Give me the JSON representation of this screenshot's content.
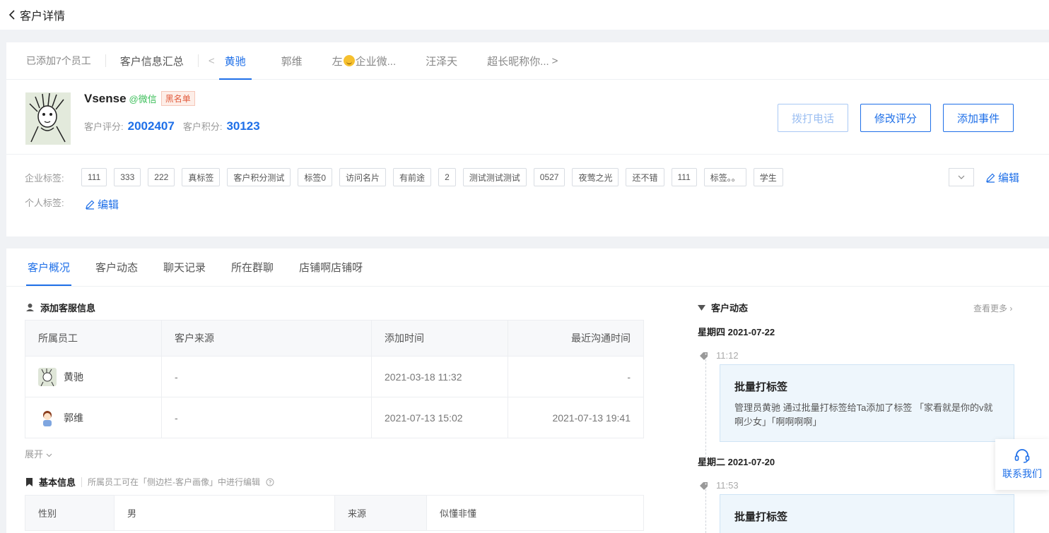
{
  "page": {
    "back_label": "客户详情"
  },
  "staff_tabs": {
    "added_count": "已添加7个员工",
    "summary": "客户信息汇总",
    "prev_arrow": "<",
    "items": [
      {
        "label": "黄驰"
      },
      {
        "label": "郭维"
      },
      {
        "label_pre": "左",
        "label_post": "企业微..."
      },
      {
        "label": "汪泽天"
      },
      {
        "label": "超长昵称你..."
      }
    ],
    "next_arrow": ">"
  },
  "profile": {
    "name": "Vsense",
    "source": "@微信",
    "badge": "黑名单",
    "rating_label": "客户评分:",
    "rating_value": "2002407",
    "points_label": "客户积分:",
    "points_value": "30123",
    "buttons": {
      "call": "拨打电话",
      "edit_score": "修改评分",
      "add_event": "添加事件"
    }
  },
  "tags": {
    "corp_label": "企业标签:",
    "corp_tags": [
      "111",
      "333",
      "222",
      "真标签",
      "客户积分测试",
      "标签0",
      "访问名片",
      "有前途",
      "2",
      "测试测试测试",
      "0527",
      "夜莺之光",
      "还不错",
      "111",
      "标签。。",
      "学生"
    ],
    "personal_label": "个人标签:",
    "edit_label": "编辑"
  },
  "detail_tabs": [
    "客户概况",
    "客户动态",
    "聊天记录",
    "所在群聊",
    "店铺啊店铺呀"
  ],
  "service_section": {
    "title": "添加客服信息",
    "headers": [
      "所属员工",
      "客户来源",
      "添加时间",
      "最近沟通时间"
    ],
    "rows": [
      {
        "staff": "黄驰",
        "source": "-",
        "added": "2021-03-18 11:32",
        "last": "-"
      },
      {
        "staff": "郭维",
        "source": "-",
        "added": "2021-07-13 15:02",
        "last": "2021-07-13 19:41"
      }
    ],
    "expand": "展开"
  },
  "basic_section": {
    "title": "基本信息",
    "note": "所属员工可在「侧边栏-客户画像」中进行编辑",
    "rows": [
      {
        "k1": "性别",
        "v1": "男",
        "k2": "来源",
        "v2": "似懂非懂"
      }
    ]
  },
  "feed": {
    "title": "客户动态",
    "see_more": "查看更多",
    "days": [
      {
        "date": "星期四 2021-07-22",
        "time": "11:12",
        "event_title": "批量打标签",
        "event_desc": "管理员黄驰  通过批量打标签给Ta添加了标签 「家看就是你的v就啊少女」「啊啊啊啊」"
      },
      {
        "date": "星期二 2021-07-20",
        "time": "11:53",
        "event_title": "批量打标签",
        "event_desc": ""
      }
    ]
  },
  "contact_us": "联系我们",
  "colors": {
    "primary": "#1e6fe8",
    "wechat_green": "#3cbf5a",
    "blacklist_red": "#e15a3c"
  }
}
